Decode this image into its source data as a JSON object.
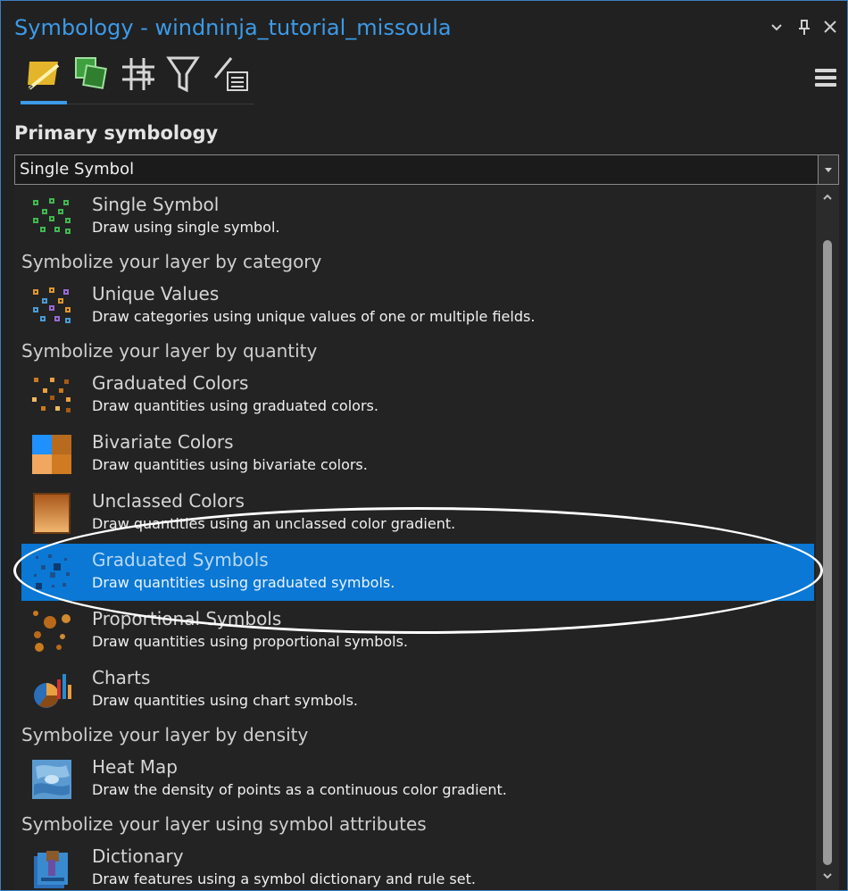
{
  "window": {
    "title": "Symbology - windninja_tutorial_missoula",
    "menu_icon": "chevron-down-icon",
    "pin_icon": "pin-icon",
    "close_icon": "close-icon"
  },
  "toolbar": {
    "tabs": [
      {
        "icon": "primary-symbology-icon",
        "active": true
      },
      {
        "icon": "vary-symbology-icon",
        "active": false
      },
      {
        "icon": "symbol-layer-drawing-icon",
        "active": false
      },
      {
        "icon": "filter-icon",
        "active": false
      },
      {
        "icon": "label-classes-icon",
        "active": false
      }
    ],
    "menu_icon": "hamburger-menu-icon"
  },
  "primary": {
    "label": "Primary symbology",
    "selected": "Single Symbol"
  },
  "list": {
    "items": [
      {
        "kind": "item",
        "title": "Single Symbol",
        "desc": "Draw using single symbol.",
        "icon": "single-symbol-icon",
        "selected": false
      },
      {
        "kind": "header",
        "text": "Symbolize your layer by category"
      },
      {
        "kind": "item",
        "title": "Unique Values",
        "desc": "Draw categories using unique values of one or multiple fields.",
        "icon": "unique-values-icon",
        "selected": false
      },
      {
        "kind": "header",
        "text": "Symbolize your layer by quantity"
      },
      {
        "kind": "item",
        "title": "Graduated Colors",
        "desc": "Draw quantities using graduated colors.",
        "icon": "graduated-colors-icon",
        "selected": false
      },
      {
        "kind": "item",
        "title": "Bivariate Colors",
        "desc": "Draw quantities using bivariate colors.",
        "icon": "bivariate-colors-icon",
        "selected": false
      },
      {
        "kind": "item",
        "title": "Unclassed Colors",
        "desc": "Draw quantities using an unclassed color gradient.",
        "icon": "unclassed-colors-icon",
        "selected": false
      },
      {
        "kind": "item",
        "title": "Graduated Symbols",
        "desc": "Draw quantities using graduated symbols.",
        "icon": "graduated-symbols-icon",
        "selected": true
      },
      {
        "kind": "item",
        "title": "Proportional Symbols",
        "desc": "Draw quantities using proportional symbols.",
        "icon": "proportional-symbols-icon",
        "selected": false
      },
      {
        "kind": "item",
        "title": "Charts",
        "desc": "Draw quantities using chart symbols.",
        "icon": "charts-icon",
        "selected": false
      },
      {
        "kind": "header",
        "text": "Symbolize your layer by density"
      },
      {
        "kind": "item",
        "title": "Heat Map",
        "desc": "Draw the density of points as a continuous color gradient.",
        "icon": "heat-map-icon",
        "selected": false
      },
      {
        "kind": "header",
        "text": "Symbolize your layer using symbol attributes"
      },
      {
        "kind": "item",
        "title": "Dictionary",
        "desc": "Draw features using a symbol dictionary and rule set.",
        "icon": "dictionary-icon",
        "selected": false
      }
    ]
  },
  "colors": {
    "accent": "#3c9ae8",
    "selection": "#0a78d4",
    "background": "#212121"
  }
}
